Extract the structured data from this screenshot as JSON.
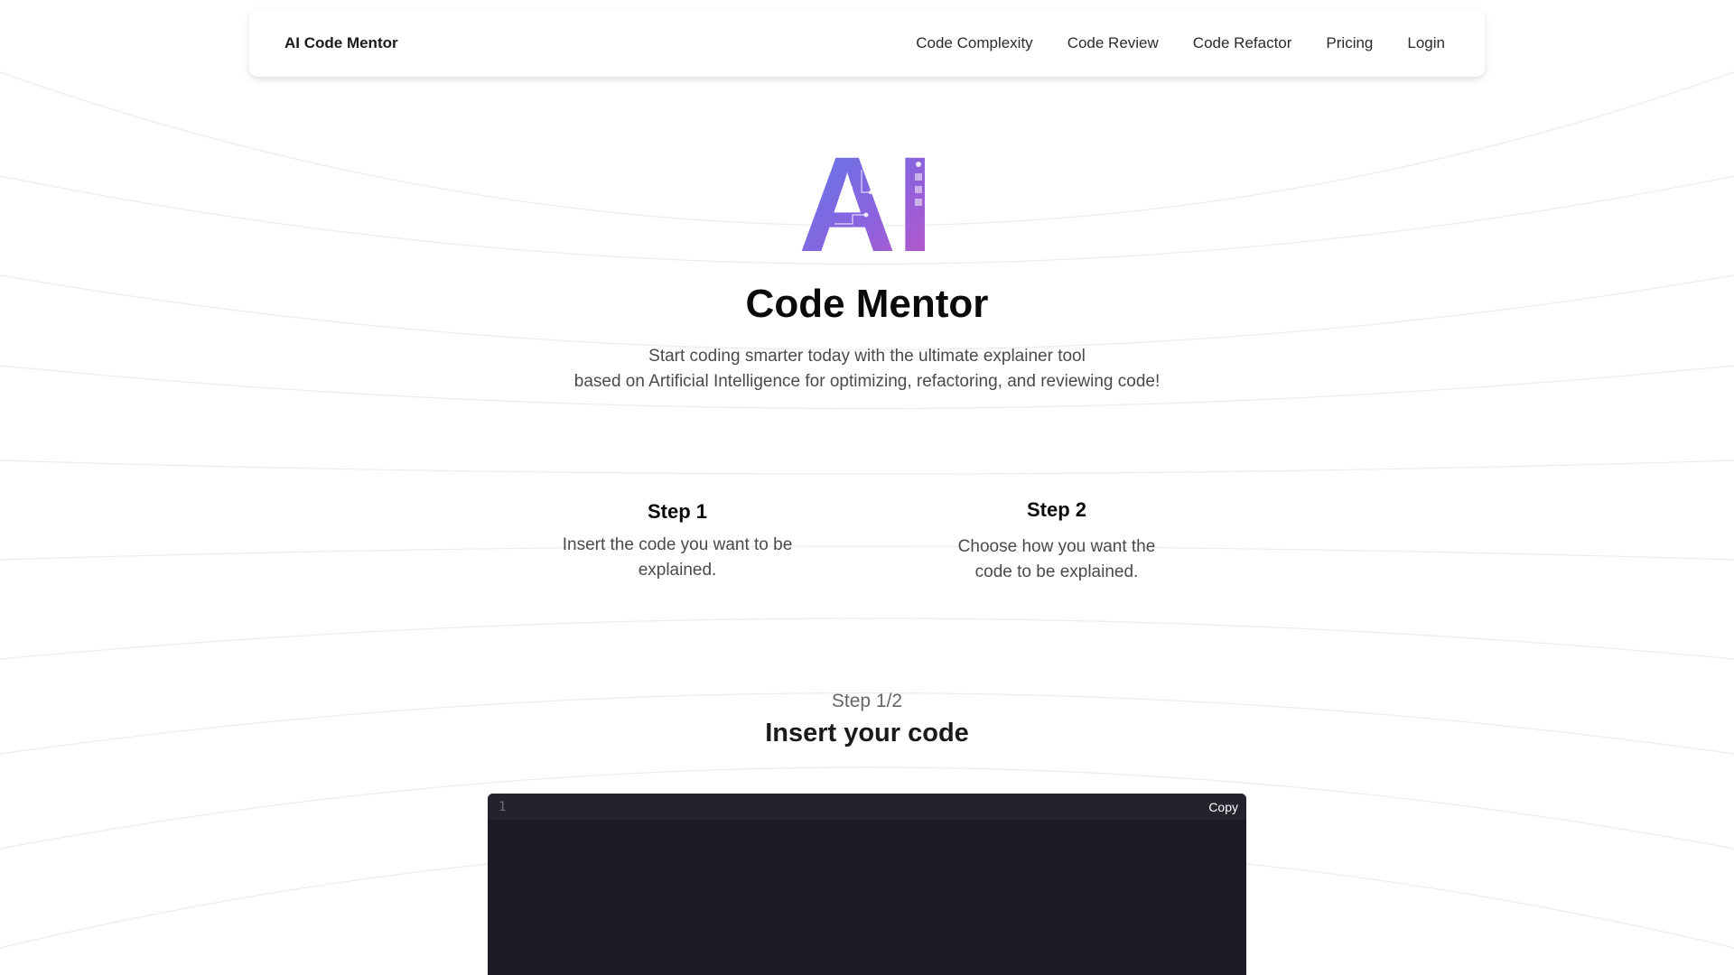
{
  "navbar": {
    "brand": "AI Code Mentor",
    "links": [
      "Code Complexity",
      "Code Review",
      "Code Refactor",
      "Pricing",
      "Login"
    ]
  },
  "hero": {
    "logo_text": "AI",
    "title": "Code Mentor",
    "subtitle_line1": "Start coding smarter today with the ultimate explainer tool",
    "subtitle_line2": "based on Artificial Intelligence for optimizing, refactoring, and reviewing code!"
  },
  "steps": [
    {
      "title": "Step 1",
      "description": "Insert the code you want to be explained."
    },
    {
      "title": "Step 2",
      "description": "Choose how you want the code to be explained."
    }
  ],
  "insert_section": {
    "step_indicator": "Step 1/2",
    "title": "Insert your code"
  },
  "editor": {
    "line_number": "1",
    "value": "",
    "copy_label": "Copy"
  },
  "colors": {
    "logo_gradient_start": "#5b7bea",
    "logo_gradient_end": "#c054c4",
    "editor_bg": "#1c1c24"
  }
}
